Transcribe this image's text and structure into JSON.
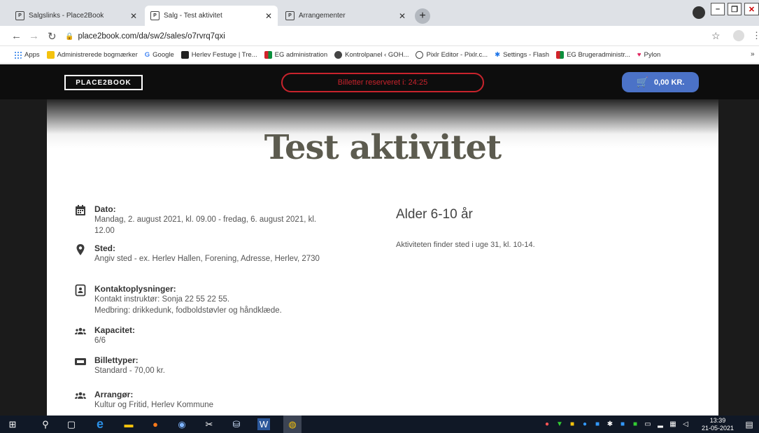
{
  "tabs": [
    {
      "title": "Salgslinks - Place2Book",
      "active": false
    },
    {
      "title": "Salg - Test aktivitet",
      "active": true
    },
    {
      "title": "Arrangementer",
      "active": false
    }
  ],
  "address_bar": {
    "url": "place2book.com/da/sw2/sales/o7rvrq7qxi"
  },
  "bookmarks": [
    {
      "label": "Apps"
    },
    {
      "label": "Administrerede bogmærker"
    },
    {
      "label": "Google"
    },
    {
      "label": "Herlev Festuge | Tre..."
    },
    {
      "label": "EG administration"
    },
    {
      "label": "Kontrolpanel ‹ GOH..."
    },
    {
      "label": "Pixlr Editor - Pixlr.c..."
    },
    {
      "label": "Settings - Flash"
    },
    {
      "label": "EG Brugeradministr..."
    },
    {
      "label": "Pylon"
    }
  ],
  "header": {
    "logo": "PLACE2BOOK",
    "timer": "Billetter reserveret i: 24:25",
    "cart_amount": "0,00 KR."
  },
  "event": {
    "title": "Test aktivitet",
    "info": [
      {
        "icon": "calendar-icon",
        "label": "Dato:",
        "value": "Mandag, 2. august 2021, kl. 09.00 - fredag, 6. august 2021, kl. 12.00"
      },
      {
        "icon": "location-pin-icon",
        "label": "Sted:",
        "value": "Angiv sted - ex. Herlev Hallen, Forening, Adresse, Herlev, 2730"
      },
      {
        "icon": "contact-card-icon",
        "label": "Kontaktoplysninger:",
        "value": "Kontakt instruktør: Sonja 22 55 22 55.\nMedbring: drikkedunk, fodboldstøvler og håndklæde."
      },
      {
        "icon": "group-icon",
        "label": "Kapacitet:",
        "value": "6/6"
      },
      {
        "icon": "ticket-icon",
        "label": "Billettyper:",
        "value": "Standard - 70,00 kr."
      },
      {
        "icon": "group-icon",
        "label": "Arrangør:",
        "value": "Kultur og Fritid, Herlev Kommune"
      }
    ],
    "age_heading": "Alder 6-10 år",
    "description": "Aktiviteten finder sted i uge 31, kl. 10-14."
  },
  "taskbar": {
    "time": "13:39",
    "date": "21-05-2021"
  }
}
